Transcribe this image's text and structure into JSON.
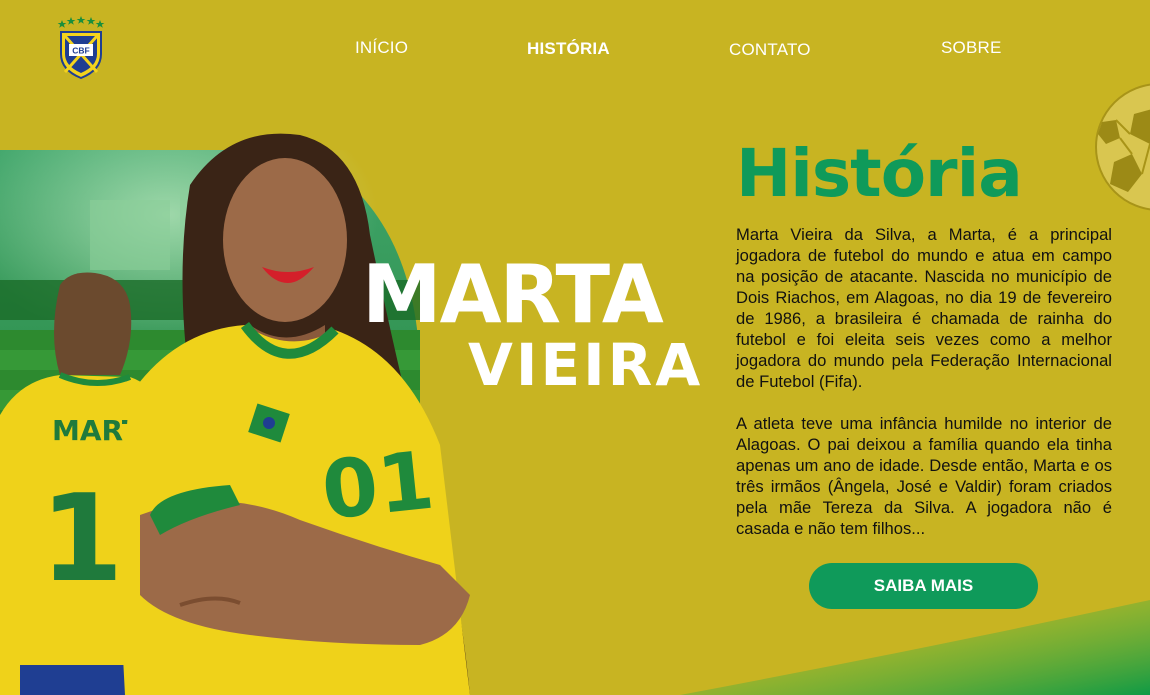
{
  "header": {
    "logo_text": "CBF",
    "nav": [
      {
        "label": "INÍCIO",
        "active": false
      },
      {
        "label": "HISTÓRIA",
        "active": true
      },
      {
        "label": "CONTATO",
        "active": false
      },
      {
        "label": "SOBRE",
        "active": false
      }
    ]
  },
  "hero": {
    "name_first": "MARTA",
    "name_last": "VIEIRA",
    "jersey_back_name": "MARTA",
    "jersey_back_number": "10"
  },
  "content": {
    "title": "História",
    "paragraphs": [
      "Marta Vieira da Silva, a Marta, é a principal jogadora de futebol do mundo e atua em campo na posição de atacante. Nascida no município de Dois Riachos, em Alagoas, no dia 19 de fevereiro de 1986, a brasileira é chamada de rainha do futebol e foi eleita seis vezes como a melhor jogadora do mundo pela Federação Internacional de Futebol (Fifa).",
      "A atleta teve uma infância humilde no interior de Alagoas. O pai deixou a família quando ela tinha apenas um ano de idade. Desde então, Marta e os três irmãos (Ângela, José e Valdir) foram criados pela mãe Tereza da Silva. A jogadora não é casada e não tem filhos..."
    ],
    "cta_label": "SAIBA MAIS"
  },
  "colors": {
    "background": "#c8b422",
    "accent_green": "#0f9a5a",
    "text": "#111111",
    "nav_text": "#ffffff"
  }
}
